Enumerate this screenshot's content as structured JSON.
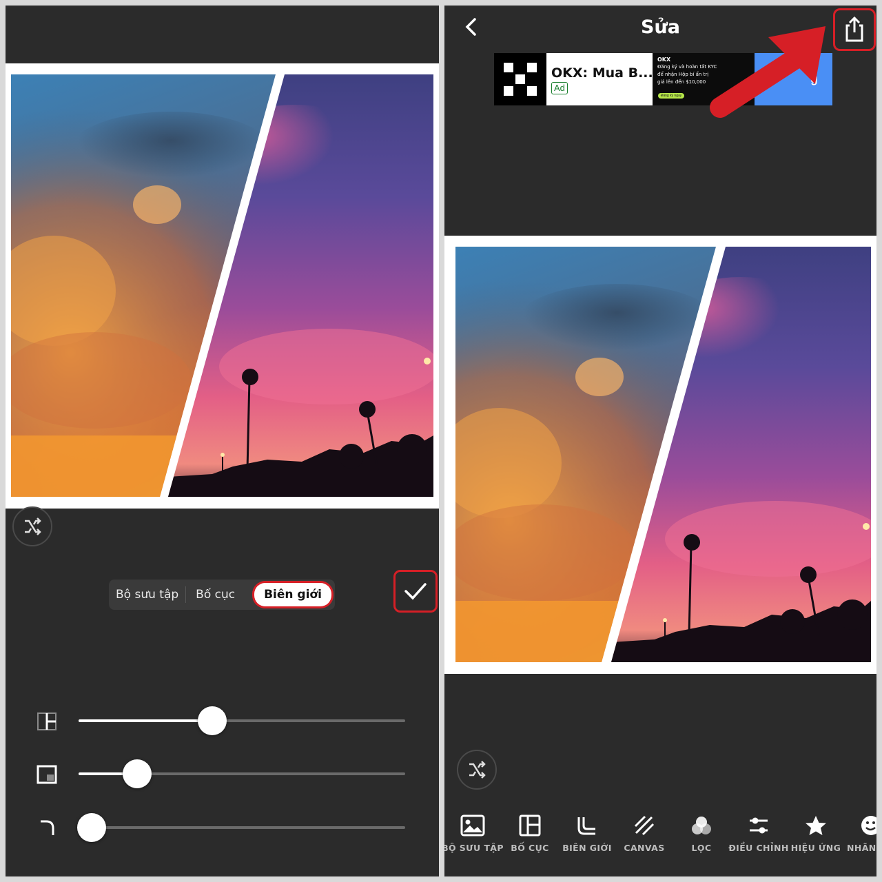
{
  "left_panel": {
    "tabs": [
      "Bộ sưu tập",
      "Bố cục",
      "Biên giới"
    ],
    "active_tab": "Biên giới",
    "sliders": [
      {
        "name": "inner-border",
        "value": 0.41
      },
      {
        "name": "outer-border",
        "value": 0.18
      },
      {
        "name": "corner-radius",
        "value": 0.04
      }
    ],
    "icons": {
      "shuffle": "shuffle-icon",
      "confirm": "checkmark-icon"
    }
  },
  "right_panel": {
    "title": "Sửa",
    "ad": {
      "headline": "OKX: Mua B...",
      "badge": "Ad",
      "banner_brand": "OKX",
      "banner_lines": [
        "Đăng ký và hoàn tất KYC",
        "để nhận Hộp bí ẩn trị",
        "giá lên đến $10,000"
      ],
      "banner_button": "Đăng ký ngay",
      "cta": "g"
    },
    "toolbar": [
      {
        "label": "BỘ SƯU TẬP",
        "icon": "image-icon"
      },
      {
        "label": "BỐ CỤC",
        "icon": "layout-icon"
      },
      {
        "label": "BIÊN GIỚI",
        "icon": "border-icon"
      },
      {
        "label": "CANVAS",
        "icon": "canvas-icon"
      },
      {
        "label": "LỌC",
        "icon": "filter-icon"
      },
      {
        "label": "ĐIỀU CHỈNH",
        "icon": "adjust-icon"
      },
      {
        "label": "HIỆU ỨNG",
        "icon": "star-icon"
      },
      {
        "label": "NHÃN",
        "icon": "sticker-icon"
      }
    ]
  },
  "colors": {
    "background": "#2b2b2b",
    "highlight_red": "#d61f26",
    "ad_cta_blue": "#4a8ff5"
  }
}
